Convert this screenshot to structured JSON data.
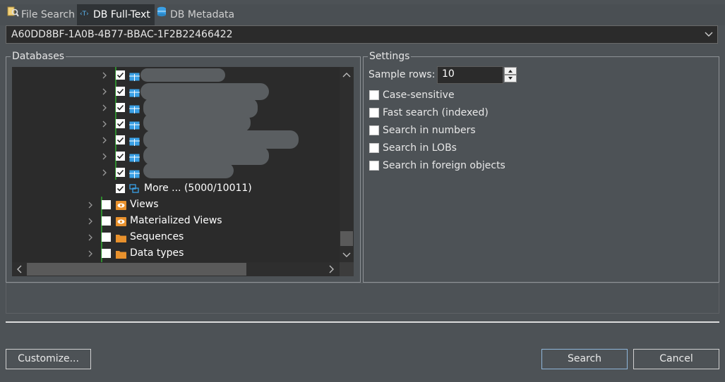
{
  "tabs": [
    {
      "label": "File Search",
      "icon": "file-search-icon",
      "active": false
    },
    {
      "label": "DB Full-Text",
      "icon": "full-text-icon",
      "active": true
    },
    {
      "label": "DB Metadata",
      "icon": "db-metadata-icon",
      "active": false
    }
  ],
  "connection": {
    "selected": "A60DD8BF-1A0B-4B77-BBAC-1F2B22466422"
  },
  "databases": {
    "title": "Databases",
    "tree": {
      "more_label": "More ... (5000/10011)",
      "folders": [
        "Views",
        "Materialized Views",
        "Sequences",
        "Data types"
      ]
    }
  },
  "settings": {
    "title": "Settings",
    "sample_rows_label": "Sample rows:",
    "sample_rows_value": "10",
    "options": [
      {
        "label": "Case-sensitive",
        "checked": false
      },
      {
        "label": "Fast search (indexed)",
        "checked": false
      },
      {
        "label": "Search in numbers",
        "checked": false
      },
      {
        "label": "Search in LOBs",
        "checked": false
      },
      {
        "label": "Search in foreign objects",
        "checked": false
      }
    ]
  },
  "buttons": {
    "customize": "Customize...",
    "search": "Search",
    "cancel": "Cancel"
  },
  "colors": {
    "background": "#4d5256",
    "tree_bg": "#2b2b2b",
    "folder_orange": "#e8912d",
    "table_blue": "#3aa0e6"
  }
}
